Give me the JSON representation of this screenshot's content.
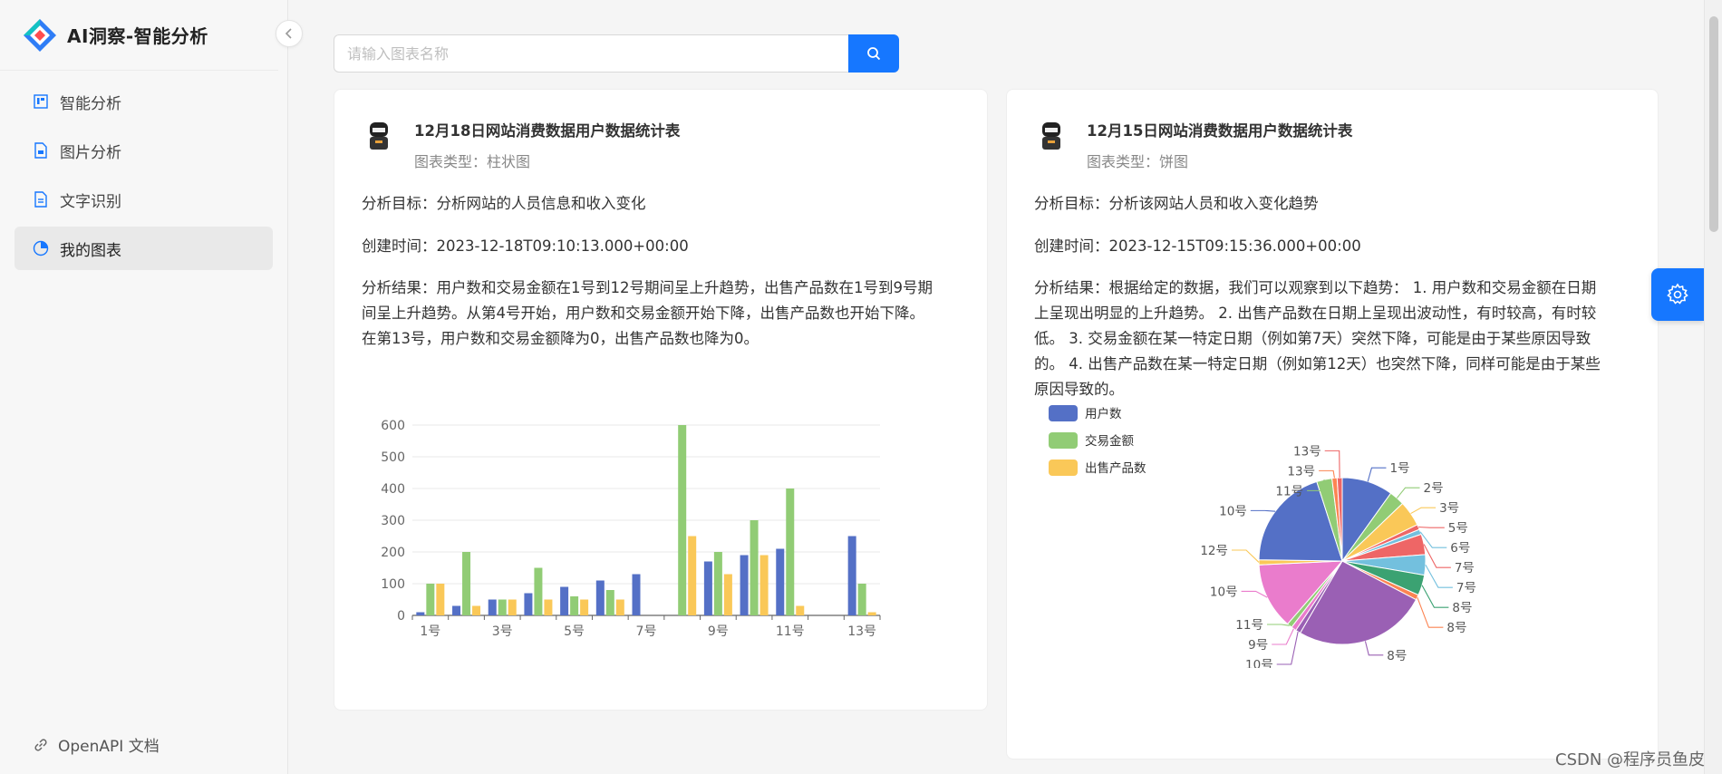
{
  "app": {
    "title": "AI洞察-智能分析"
  },
  "sidebar": {
    "collapse_icon": "chevron-left-icon",
    "items": [
      {
        "label": "智能分析",
        "icon": "dashboard-icon",
        "active": false
      },
      {
        "label": "图片分析",
        "icon": "file-image-icon",
        "active": false
      },
      {
        "label": "文字识别",
        "icon": "file-text-icon",
        "active": false
      },
      {
        "label": "我的图表",
        "icon": "pie-chart-icon",
        "active": true
      }
    ],
    "bottom_link": {
      "label": "OpenAPI 文档",
      "icon": "link-icon"
    }
  },
  "search": {
    "placeholder": "请输入图表名称",
    "value": "",
    "button_icon": "search-icon"
  },
  "cards": [
    {
      "title": "12月18日网站消费数据用户数据统计表",
      "chart_type": "图表类型：柱状图",
      "goal": "分析目标：分析网站的人员信息和收入变化",
      "created": "创建时间：2023-12-18T09:10:13.000+00:00",
      "result_lines": [
        "分析结果：用户数和交易金额在1号到12号期间呈上升趋势，出售产品数在1号到9号期",
        "间呈上升趋势。从第4号开始，用户数和交易金额开始下降，出售产品数也开始下降。",
        "在第13号，用户数和交易金额降为0，出售产品数也降为0。"
      ]
    },
    {
      "title": "12月15日网站消费数据用户数据统计表",
      "chart_type": "图表类型：饼图",
      "goal": "分析目标：分析该网站人员和收入变化趋势",
      "created": "创建时间：2023-12-15T09:15:36.000+00:00",
      "result_lines": [
        "分析结果：根据给定的数据，我们可以观察到以下趋势： 1. 用户数和交易金额在日期",
        "上呈现出明显的上升趋势。 2. 出售产品数在日期上呈现出波动性，有时较高，有时较",
        "低。 3. 交易金额在某一特定日期（例如第7天）突然下降，可能是由于某些原因导致",
        "的。 4. 出售产品数在某一特定日期（例如第12天）也突然下降，同样可能是由于某些",
        "原因导致的。"
      ]
    }
  ],
  "fab": {
    "icon": "gear-icon"
  },
  "watermark": "CSDN @程序员鱼皮",
  "colors": {
    "accent": "#1677ff",
    "blue": "#5470c6",
    "green": "#91cc75",
    "yellow": "#fac858",
    "red": "#ee6666",
    "cyan": "#73c0de",
    "teal": "#3ba272",
    "orange": "#fc8452",
    "purple": "#9a60b4",
    "pink": "#ea7ccc"
  },
  "chart_data": [
    {
      "type": "bar",
      "categories": [
        "1号",
        "2号",
        "3号",
        "4号",
        "5号",
        "6号",
        "7号",
        "8号",
        "9号",
        "10号",
        "11号",
        "12号",
        "13号"
      ],
      "x_tick_labels": [
        "1号",
        "3号",
        "5号",
        "7号",
        "9号",
        "11号",
        "13号"
      ],
      "ylim": [
        0,
        600
      ],
      "y_ticks": [
        0,
        100,
        200,
        300,
        400,
        500,
        600
      ],
      "grid": true,
      "series": [
        {
          "name": "用户数",
          "color": "#5470c6",
          "values": [
            10,
            30,
            50,
            70,
            90,
            110,
            130,
            0,
            170,
            190,
            210,
            0,
            250
          ]
        },
        {
          "name": "交易金额",
          "color": "#91cc75",
          "values": [
            100,
            200,
            50,
            150,
            60,
            80,
            0,
            600,
            200,
            300,
            400,
            0,
            100
          ]
        },
        {
          "name": "出售产品数",
          "color": "#fac858",
          "values": [
            100,
            30,
            50,
            50,
            50,
            50,
            0,
            250,
            130,
            190,
            30,
            0,
            10
          ]
        }
      ]
    },
    {
      "type": "pie",
      "legend": [
        {
          "name": "用户数",
          "color": "#5470c6"
        },
        {
          "name": "交易金额",
          "color": "#91cc75"
        },
        {
          "name": "出售产品数",
          "color": "#fac858"
        }
      ],
      "legend_position": "top-left",
      "slices": [
        {
          "label": "1号",
          "value": 10,
          "color": "#5470c6"
        },
        {
          "label": "2号",
          "value": 3,
          "color": "#91cc75"
        },
        {
          "label": "3号",
          "value": 5,
          "color": "#fac858"
        },
        {
          "label": "5号",
          "value": 1,
          "color": "#ee6666"
        },
        {
          "label": "6号",
          "value": 1,
          "color": "#73c0de"
        },
        {
          "label": "7号",
          "value": 4,
          "color": "#ee6666"
        },
        {
          "label": "7号",
          "value": 4,
          "color": "#73c0de"
        },
        {
          "label": "8号",
          "value": 4,
          "color": "#3ba272"
        },
        {
          "label": "8号",
          "value": 1,
          "color": "#fc8452"
        },
        {
          "label": "8号",
          "value": 26,
          "color": "#9a60b4"
        },
        {
          "label": "10号",
          "value": 1,
          "color": "#9a60b4"
        },
        {
          "label": "9号",
          "value": 1,
          "color": "#ea7ccc"
        },
        {
          "label": "11号",
          "value": 1,
          "color": "#91cc75"
        },
        {
          "label": "10号",
          "value": 13,
          "color": "#ea7ccc"
        },
        {
          "label": "12号",
          "value": 1,
          "color": "#fac858"
        },
        {
          "label": "10号",
          "value": 20,
          "color": "#5470c6"
        },
        {
          "label": "11号",
          "value": 3,
          "color": "#91cc75"
        },
        {
          "label": "13号",
          "value": 1,
          "color": "#fc8452"
        },
        {
          "label": "13号",
          "value": 1,
          "color": "#ee6666"
        }
      ]
    }
  ]
}
